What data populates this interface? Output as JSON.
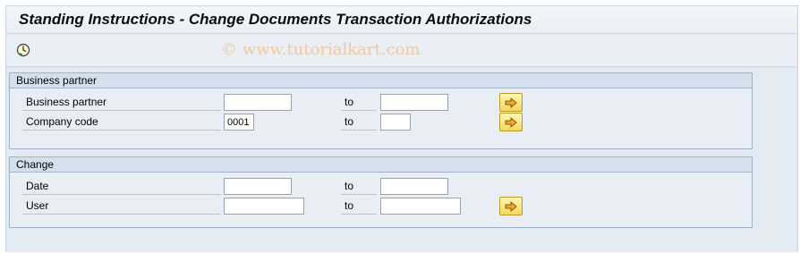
{
  "window": {
    "title": "Standing Instructions - Change Documents Transaction Authorizations"
  },
  "toolbar": {
    "execute_icon": "execute-icon",
    "watermark": "© www.tutorialkart.com"
  },
  "business_partner_group": {
    "header": "Business partner",
    "rows": [
      {
        "label": "Business partner",
        "from_value": "",
        "to_label": "to",
        "to_value": ""
      },
      {
        "label": "Company code",
        "from_value": "0001",
        "to_label": "to",
        "to_value": ""
      }
    ]
  },
  "change_group": {
    "header": "Change",
    "rows": [
      {
        "label": "Date",
        "from_value": "",
        "to_label": "to",
        "to_value": ""
      },
      {
        "label": "User",
        "from_value": "",
        "to_label": "to",
        "to_value": ""
      }
    ]
  },
  "icons": {
    "multiple_selection": "arrow-right-icon"
  },
  "colors": {
    "window_bg": "#e2eaf2",
    "group_header_bg": "#d3e0ec",
    "button_yellow": "#f3d85a"
  }
}
